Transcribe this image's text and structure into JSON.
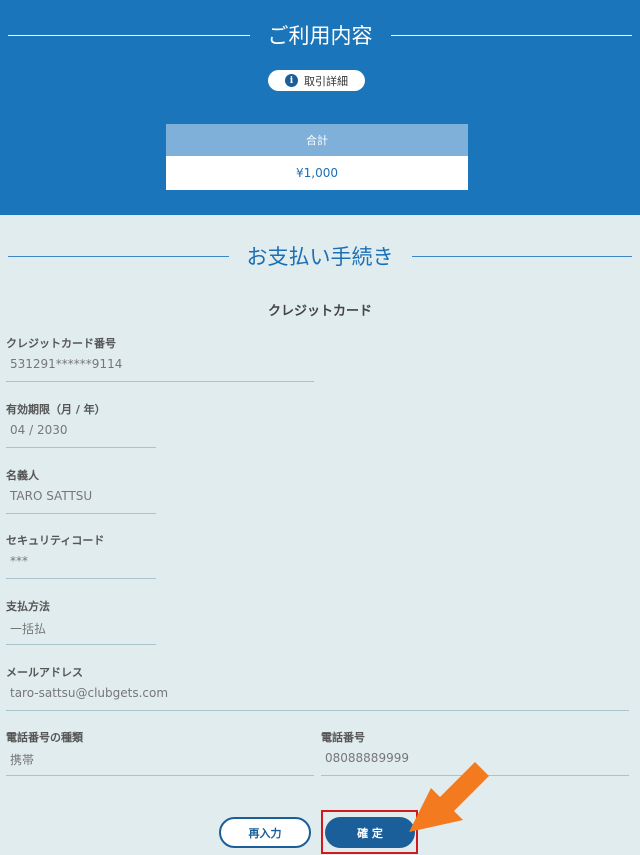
{
  "summary": {
    "heading": "ご利用内容",
    "detail_button": "取引詳細",
    "total_label": "合計",
    "total_value": "¥1,000"
  },
  "payment": {
    "heading": "お支払い手続き",
    "method_title": "クレジットカード",
    "fields": {
      "card_number": {
        "label": "クレジットカード番号",
        "value": "531291******9114"
      },
      "expiry": {
        "label": "有効期限（月 / 年）",
        "value": "04 / 2030"
      },
      "holder": {
        "label": "名義人",
        "value": "TARO SATTSU"
      },
      "security_code": {
        "label": "セキュリティコード",
        "value": "***"
      },
      "pay_method": {
        "label": "支払方法",
        "value": "一括払"
      },
      "email": {
        "label": "メールアドレス",
        "value": "taro-sattsu@clubgets.com"
      },
      "phone_type": {
        "label": "電話番号の種類",
        "value": "携帯"
      },
      "phone": {
        "label": "電話番号",
        "value": "08088889999"
      }
    }
  },
  "buttons": {
    "reenter": "再入力",
    "confirm": "確 定"
  },
  "colors": {
    "header_bg": "#1a75ba",
    "page_bg": "#e1ecee",
    "button_blue": "#1a5f9a",
    "highlight_red": "#d4191d",
    "arrow_orange": "#f47a20"
  },
  "icons": {
    "info": "info-icon",
    "arrow": "pointer-arrow-icon"
  }
}
